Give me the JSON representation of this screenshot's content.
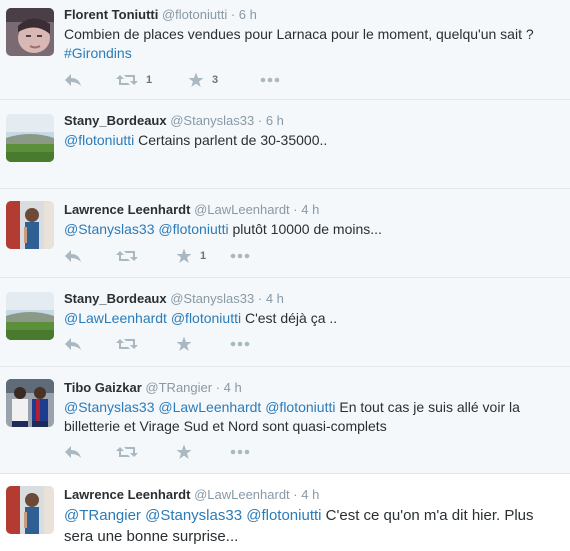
{
  "tweets": [
    {
      "fullname": "Florent Toniutti",
      "username": "@flotoniutti",
      "time": "· 6 h",
      "text_parts": [
        {
          "t": "Combien de places vendues pour Larnaca pour le moment, quelqu'un sait ? ",
          "link": false
        },
        {
          "t": "#Girondins",
          "link": true
        }
      ],
      "retweets": "1",
      "favorites": "3",
      "avatar_icon": "profile-photo-selfie-icon"
    },
    {
      "fullname": "Stany_Bordeaux",
      "username": "@Stanyslas33",
      "time": "· 6 h",
      "text_parts": [
        {
          "t": "@flotoniutti",
          "link": true
        },
        {
          "t": " Certains parlent de 30-35000..",
          "link": false
        }
      ],
      "retweets": "",
      "favorites": "",
      "avatar_icon": "profile-photo-stadium-icon"
    },
    {
      "fullname": "Lawrence Leenhardt",
      "username": "@LawLeenhardt",
      "time": "· 4 h",
      "text_parts": [
        {
          "t": "@Stanyslas33",
          "link": true
        },
        {
          "t": " ",
          "link": false
        },
        {
          "t": "@flotoniutti",
          "link": true
        },
        {
          "t": " plutôt 10000 de moins...",
          "link": false
        }
      ],
      "retweets": "",
      "favorites": "1",
      "avatar_icon": "profile-photo-person-icon"
    },
    {
      "fullname": "Stany_Bordeaux",
      "username": "@Stanyslas33",
      "time": "· 4 h",
      "text_parts": [
        {
          "t": "@LawLeenhardt",
          "link": true
        },
        {
          "t": " ",
          "link": false
        },
        {
          "t": "@flotoniutti",
          "link": true
        },
        {
          "t": " C'est déjà ça ..",
          "link": false
        }
      ],
      "retweets": "",
      "favorites": "",
      "avatar_icon": "profile-photo-stadium-icon"
    },
    {
      "fullname": "Tibo Gaizkar",
      "username": "@TRangier",
      "time": "· 4 h",
      "text_parts": [
        {
          "t": "@Stanyslas33",
          "link": true
        },
        {
          "t": " ",
          "link": false
        },
        {
          "t": "@LawLeenhardt",
          "link": true
        },
        {
          "t": " ",
          "link": false
        },
        {
          "t": "@flotoniutti",
          "link": true
        },
        {
          "t": " En tout cas je suis allé voir la billetterie et Virage Sud et Nord sont quasi-complets",
          "link": false
        }
      ],
      "retweets": "",
      "favorites": "",
      "avatar_icon": "profile-photo-footballers-icon"
    },
    {
      "fullname": "Lawrence Leenhardt",
      "username": "@LawLeenhardt",
      "time": "· 4 h",
      "text_parts": [
        {
          "t": "@TRangier",
          "link": true
        },
        {
          "t": " ",
          "link": false
        },
        {
          "t": "@Stanyslas33",
          "link": true
        },
        {
          "t": " ",
          "link": false
        },
        {
          "t": "@flotoniutti",
          "link": true
        },
        {
          "t": " C'est ce qu'on m'a dit hier. Plus sera une bonne surprise...",
          "link": false
        }
      ],
      "retweets": "",
      "favorites": "",
      "avatar_icon": "profile-photo-person-icon"
    }
  ],
  "colors": {
    "link": "#2b7bb9",
    "icon": "#aab8c2",
    "muted": "#8899a6",
    "background": "#f5f8fa",
    "highlight_background": "#ffffff"
  }
}
